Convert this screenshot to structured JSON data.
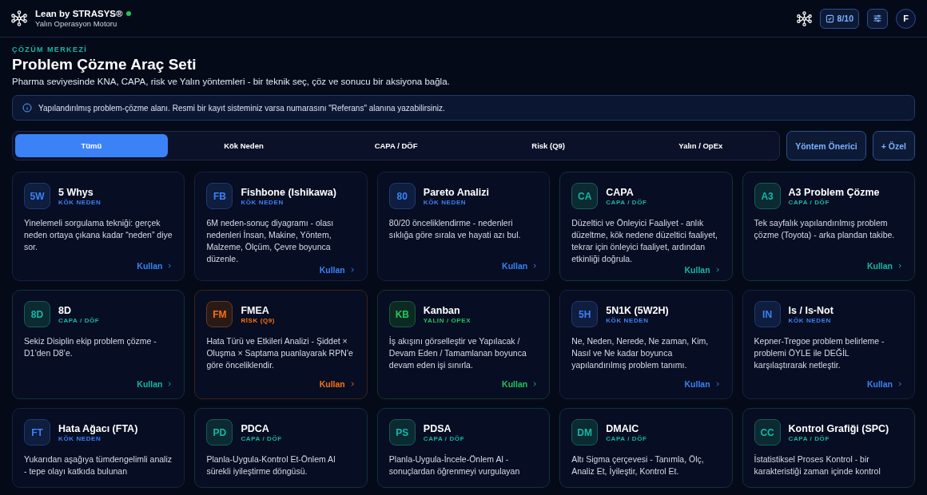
{
  "header": {
    "brand": "Lean by STRASYS®",
    "online": true,
    "subtitle": "Yalın Operasyon Motoru",
    "task_count": "8/10",
    "avatar": "F"
  },
  "hero": {
    "eyebrow": "ÇÖZÜM MERKEZİ",
    "title": "Problem Çözme Araç Seti",
    "subtitle": "Pharma seviyesinde KNA, CAPA, risk ve Yalın yöntemleri - bir teknik seç, çöz ve sonucu bir aksiyona bağla."
  },
  "notice": {
    "text": "Yapılandırılmış problem-çözme alanı. Resmi bir kayıt sisteminiz varsa numarasını \"Referans\" alanına yazabilirsiniz."
  },
  "tabs": [
    {
      "label": "Tümü",
      "selected": true
    },
    {
      "label": "Kök Neden",
      "selected": false
    },
    {
      "label": "CAPA / DÖF",
      "selected": false
    },
    {
      "label": "Risk (Q9)",
      "selected": false
    },
    {
      "label": "Yalın / OpEx",
      "selected": false
    }
  ],
  "actions": [
    "Yöntem Önerici",
    "+ Özel"
  ],
  "tools": [
    {
      "code": "5W",
      "name": "5 Whys",
      "kind": "root",
      "category": "KÖK NEDEN",
      "description": "Yinelemeli sorgulama tekniği: gerçek neden ortaya çıkana kadar “neden” diye sor.",
      "action": "Kullan"
    },
    {
      "code": "FB",
      "name": "Fishbone (Ishikawa)",
      "kind": "root",
      "category": "KÖK NEDEN",
      "description": "6M neden-sonuç diyagramı - olası nedenleri İnsan, Makine, Yöntem, Malzeme, Ölçüm, Çevre boyunca düzenle.",
      "action": "Kullan"
    },
    {
      "code": "80",
      "name": "Pareto Analizi",
      "kind": "root",
      "category": "KÖK NEDEN",
      "description": "80/20 önceliklendirme - nedenleri sıklığa göre sırala ve hayati azı bul.",
      "action": "Kullan"
    },
    {
      "code": "CA",
      "name": "CAPA",
      "kind": "capa",
      "category": "CAPA / DÖF",
      "description": "Düzeltici ve Önleyici Faaliyet - anlık düzeltme, kök nedene düzeltici faaliyet, tekrar için önleyici faaliyet, ardından etkinliği doğrula.",
      "action": "Kullan"
    },
    {
      "code": "A3",
      "name": "A3 Problem Çözme",
      "kind": "capa",
      "category": "CAPA / DÖF",
      "description": "Tek sayfalık yapılandırılmış problem çözme (Toyota) - arka plandan takibe.",
      "action": "Kullan"
    },
    {
      "code": "8D",
      "name": "8D",
      "kind": "capa",
      "category": "CAPA / DÖF",
      "description": "Sekiz Disiplin ekip problem çözme - D1’den D8’e.",
      "action": "Kullan"
    },
    {
      "code": "FM",
      "name": "FMEA",
      "kind": "risk",
      "category": "RİSK (Q9)",
      "description": "Hata Türü ve Etkileri Analizi - Şiddet × Oluşma × Saptama puanlayarak RPN’e göre önceliklendir.",
      "action": "Kullan"
    },
    {
      "code": "KB",
      "name": "Kanban",
      "kind": "lean",
      "category": "YALIN / OPEX",
      "description": "İş akışını görselleştir ve Yapılacak / Devam Eden / Tamamlanan boyunca devam eden işi sınırla.",
      "action": "Kullan"
    },
    {
      "code": "5H",
      "name": "5N1K (5W2H)",
      "kind": "root",
      "category": "KÖK NEDEN",
      "description": "Ne, Neden, Nerede, Ne zaman, Kim, Nasıl ve Ne kadar boyunca yapılandırılmış problem tanımı.",
      "action": "Kullan"
    },
    {
      "code": "IN",
      "name": "Is / Is-Not",
      "kind": "root",
      "category": "KÖK NEDEN",
      "description": "Kepner-Tregoe problem belirleme - problemi ÖYLE ile DEĞİL karşılaştırarak netleştir.",
      "action": "Kullan"
    },
    {
      "code": "FT",
      "name": "Hata Ağacı (FTA)",
      "kind": "root",
      "category": "KÖK NEDEN",
      "description": "Yukarıdan aşağıya tümdengelimli analiz - tepe olayı katkıda bulunan"
    },
    {
      "code": "PD",
      "name": "PDCA",
      "kind": "capa",
      "category": "CAPA / DÖF",
      "description": "Planla-Uygula-Kontrol Et-Önlem Al sürekli iyileştirme döngüsü."
    },
    {
      "code": "PS",
      "name": "PDSA",
      "kind": "capa",
      "category": "CAPA / DÖF",
      "description": "Planla-Uygula-İncele-Önlem Al - sonuçlardan öğrenmeyi vurgulayan"
    },
    {
      "code": "DM",
      "name": "DMAIC",
      "kind": "capa",
      "category": "CAPA / DÖF",
      "description": "Altı Sigma çerçevesi - Tanımla, Ölç, Analiz Et, İyileştir, Kontrol Et."
    },
    {
      "code": "CC",
      "name": "Kontrol Grafiği (SPC)",
      "kind": "capa",
      "category": "CAPA / DÖF",
      "description": "İstatistiksel Proses Kontrol - bir karakteristiği zaman içinde kontrol"
    }
  ]
}
